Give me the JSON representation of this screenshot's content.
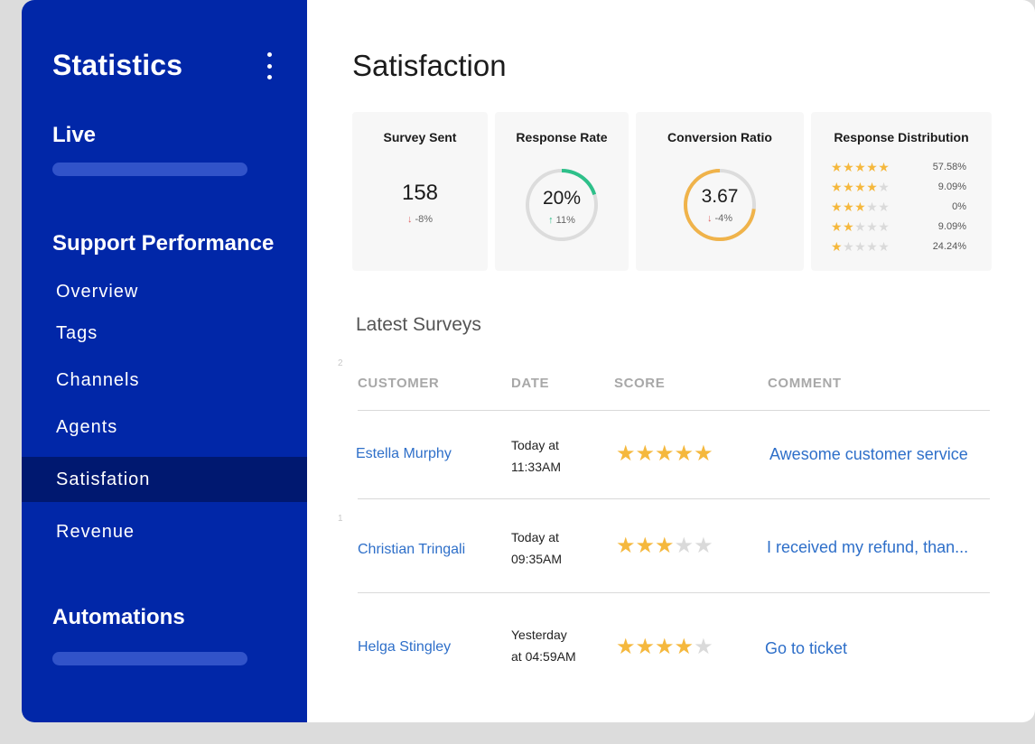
{
  "sidebar": {
    "title": "Statistics",
    "live_label": "Live",
    "support_label": "Support Performance",
    "nav": [
      "Overview",
      "Tags",
      "Channels",
      "Agents",
      "Satisfation",
      "Revenue"
    ],
    "active": "Satisfation",
    "automations_label": "Automations"
  },
  "main": {
    "title": "Satisfaction",
    "cards": {
      "survey_sent": {
        "title": "Survey Sent",
        "value": "158",
        "delta": "-8%"
      },
      "response_rate": {
        "title": "Response Rate",
        "value": "20%",
        "delta": "11%",
        "progress": 0.2
      },
      "conversion_ratio": {
        "title": "Conversion Ratio",
        "value": "3.67",
        "delta": "-4%",
        "progress": 0.73
      },
      "distribution": {
        "title": "Response Distribution",
        "rows": [
          {
            "stars": 5,
            "pct": "57.58%"
          },
          {
            "stars": 4,
            "pct": "9.09%"
          },
          {
            "stars": 3,
            "pct": "0%"
          },
          {
            "stars": 2,
            "pct": "9.09%"
          },
          {
            "stars": 1,
            "pct": "24.24%"
          }
        ]
      }
    },
    "latest": {
      "title": "Latest Surveys",
      "headers": {
        "customer": "CUSTOMER",
        "date": "DATE",
        "score": "SCORE",
        "comment": "COMMENT"
      },
      "row_markers": [
        "2",
        "1"
      ],
      "rows": [
        {
          "customer": "Estella Murphy",
          "date_line1": "Today at",
          "date_line2": "11:33AM",
          "score": 5,
          "comment": "Awesome customer service"
        },
        {
          "customer": "Christian Tringali",
          "date_line1": "Today at",
          "date_line2": "09:35AM",
          "score": 3,
          "comment": "I received my refund, than..."
        },
        {
          "customer": "Helga Stingley",
          "date_line1": "Yesterday",
          "date_line2": "at 04:59AM",
          "score": 4,
          "comment": "Go to ticket"
        }
      ]
    }
  },
  "colors": {
    "sidebar_bg": "#0127a8",
    "sidebar_active": "#001870",
    "star": "#f5b83d",
    "star_empty": "#dadada",
    "link": "#2e6fc9",
    "positive": "#2ec08a",
    "negative": "#e06464",
    "conversion_ring": "#f0b34a"
  },
  "icons": {
    "menu": "more-vertical-icon",
    "down": "arrow-down-icon",
    "up": "arrow-up-icon",
    "star": "star-icon"
  }
}
